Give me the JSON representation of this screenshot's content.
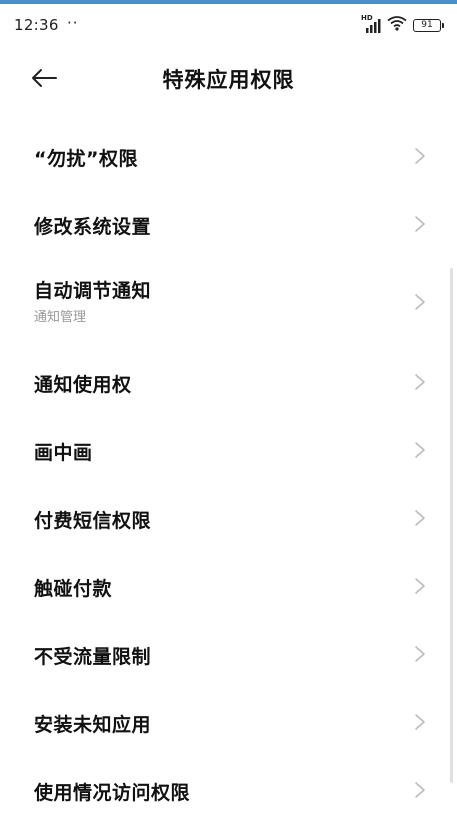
{
  "status_bar": {
    "time": "12:36",
    "dots": "··",
    "hd_label": "HD",
    "battery_level": "91"
  },
  "header": {
    "title": "特殊应用权限"
  },
  "items": [
    {
      "label": "“勿扰”权限",
      "sub": ""
    },
    {
      "label": "修改系统设置",
      "sub": ""
    },
    {
      "label": "自动调节通知",
      "sub": "通知管理"
    },
    {
      "label": "通知使用权",
      "sub": ""
    },
    {
      "label": "画中画",
      "sub": ""
    },
    {
      "label": "付费短信权限",
      "sub": ""
    },
    {
      "label": "触碰付款",
      "sub": ""
    },
    {
      "label": "不受流量限制",
      "sub": ""
    },
    {
      "label": "安装未知应用",
      "sub": ""
    },
    {
      "label": "使用情况访问权限",
      "sub": ""
    }
  ],
  "colors": {
    "accent_bar": "#4a90c8",
    "text_primary": "#111111",
    "text_secondary": "#999999",
    "chevron": "#bbbbbb"
  }
}
